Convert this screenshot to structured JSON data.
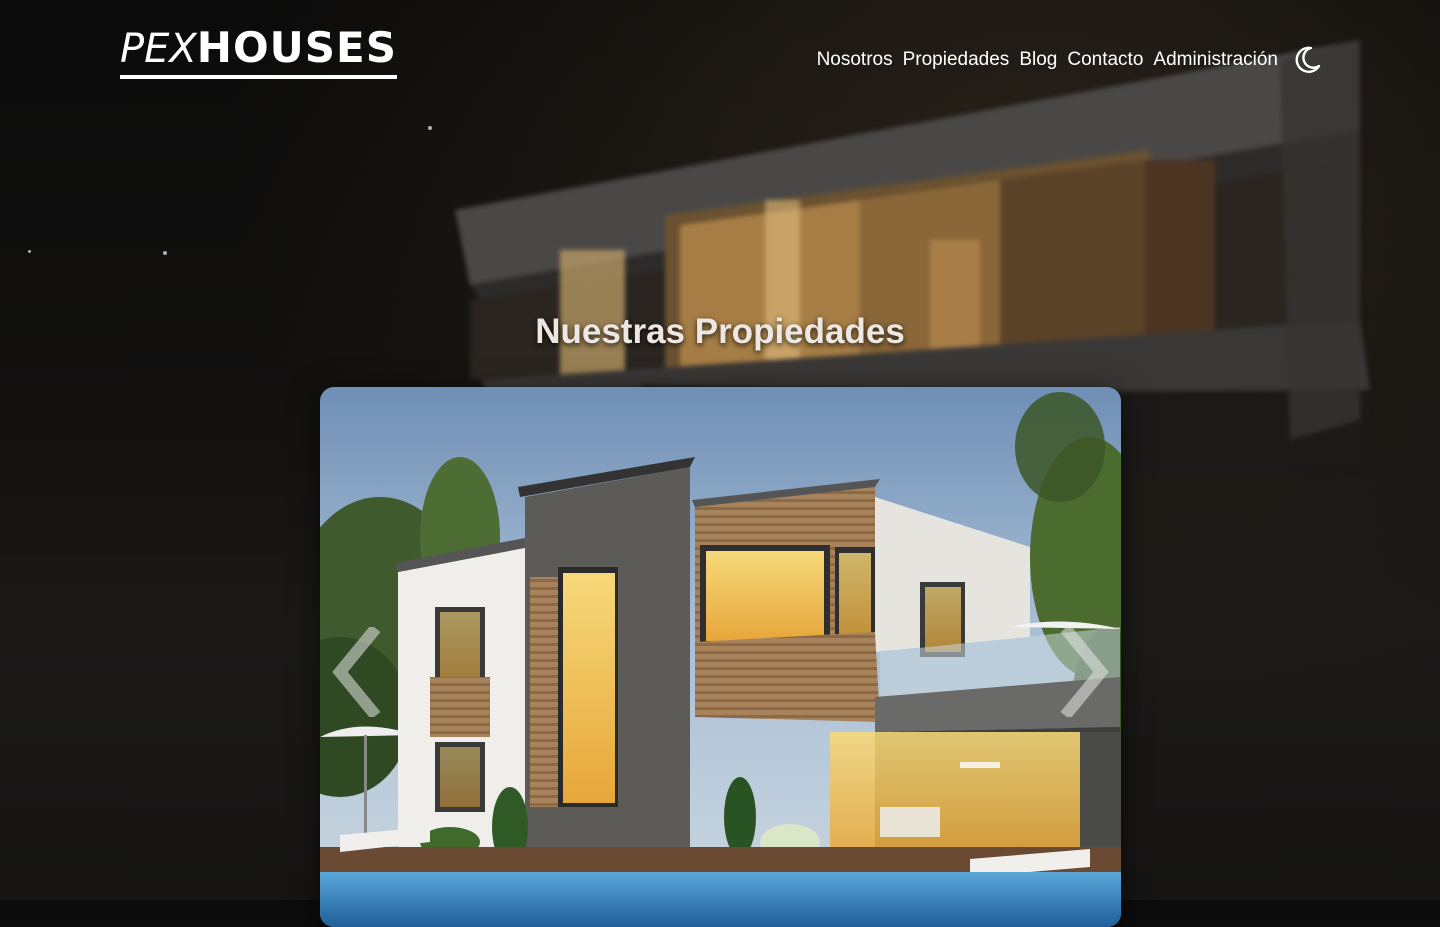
{
  "brand": {
    "logo_light": "PEX",
    "logo_bold": "HOUSES"
  },
  "nav": {
    "items": [
      {
        "label": "Nosotros"
      },
      {
        "label": "Propiedades"
      },
      {
        "label": "Blog"
      },
      {
        "label": "Contacto"
      },
      {
        "label": "Administración"
      }
    ],
    "theme_toggle_icon": "moon-icon"
  },
  "hero": {
    "title": "Nuestras Propiedades"
  },
  "carousel": {
    "prev_icon": "chevron-left-icon",
    "next_icon": "chevron-right-icon",
    "slide_image": "modern-house-photo"
  },
  "colors": {
    "background": "#0d0c0c",
    "text": "#ffffff",
    "title": "#ece7e2"
  }
}
